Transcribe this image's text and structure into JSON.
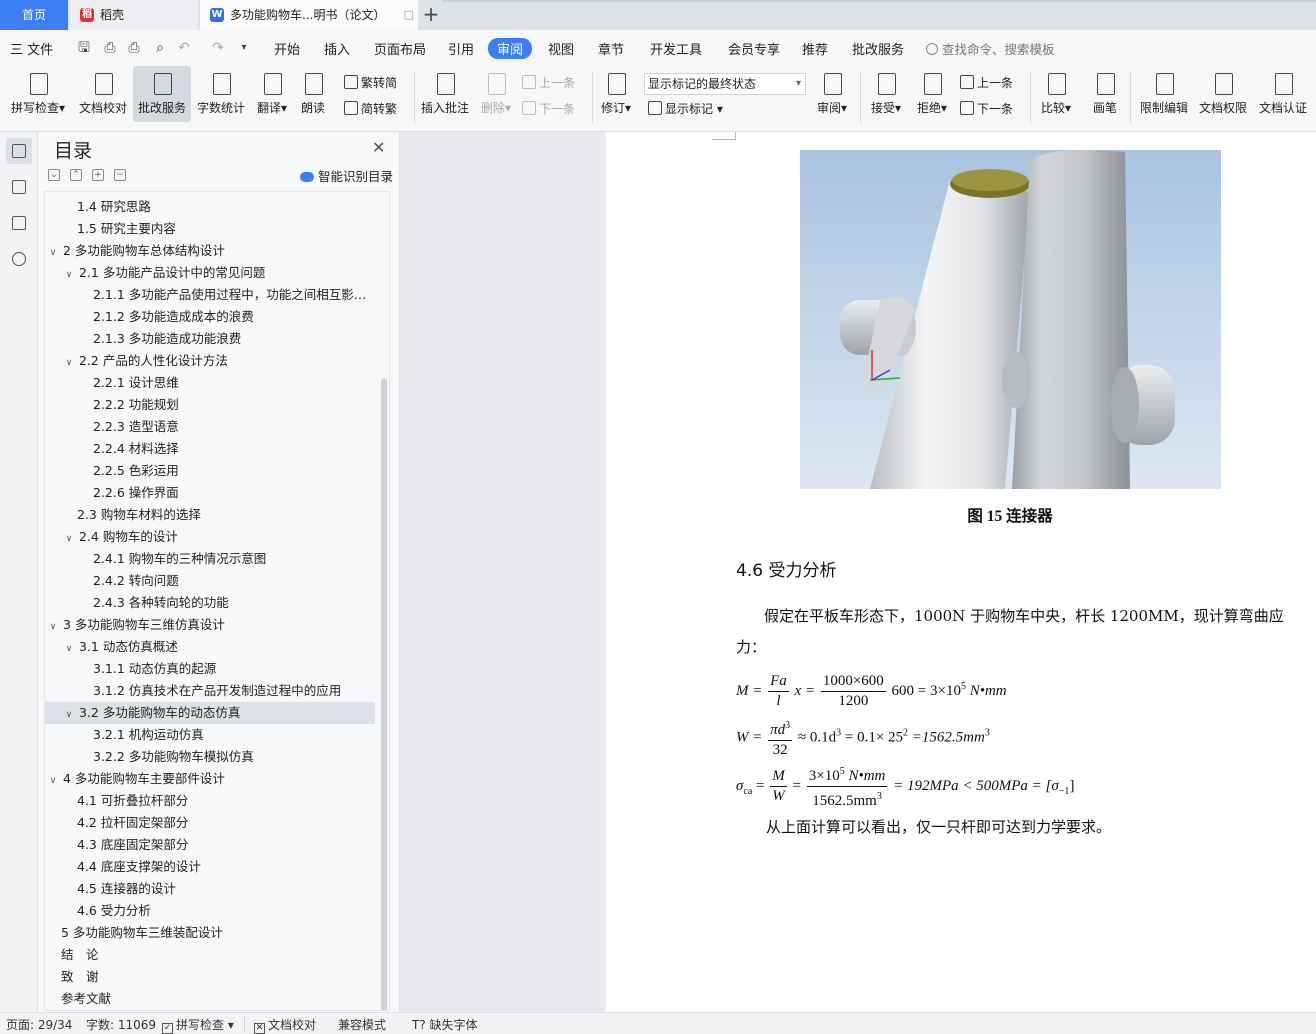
{
  "tabs": {
    "home": "首页",
    "daoke": "稻壳",
    "doc": "多功能购物车...明书（论文）"
  },
  "menubar": {
    "file": "三 文件",
    "items": [
      "开始",
      "插入",
      "页面布局",
      "引用",
      "审阅",
      "视图",
      "章节",
      "开发工具",
      "会员专享",
      "推荐",
      "批改服务"
    ],
    "active": "审阅",
    "search": "查找命令、搜索模板"
  },
  "ribbon": {
    "spell": "拼写检查",
    "proofread": "文档校对",
    "correction": "批改服务",
    "wordcount": "字数统计",
    "translate": "翻译",
    "read": "朗读",
    "trad": "繁转简",
    "simp": "简转繁",
    "insert_comment": "插入批注",
    "delete": "删除",
    "prev": "上一条",
    "next": "下一条",
    "revise": "修订",
    "markup_state": "显示标记的最终状态",
    "show_markup": "显示标记",
    "review": "审阅",
    "accept": "接受",
    "reject": "拒绝",
    "prev2": "上一条",
    "next2": "下一条",
    "compare": "比较",
    "pen": "画笔",
    "restrict": "限制编辑",
    "permission": "文档权限",
    "certify": "文档认证"
  },
  "toc": {
    "title": "目录",
    "smart": "智能识别目录",
    "items": [
      {
        "text": "1.4 研究思路",
        "level": 2,
        "arrow": ""
      },
      {
        "text": "1.5 研究主要内容",
        "level": 2,
        "arrow": ""
      },
      {
        "text": "2  多功能购物车总体结构设计",
        "level": 1,
        "arrow": "v"
      },
      {
        "text": "2.1  多功能产品设计中的常见问题",
        "level": 2,
        "arrow": "v"
      },
      {
        "text": "2.1.1  多功能产品使用过程中，功能之间相互影…",
        "level": 3,
        "arrow": ""
      },
      {
        "text": "2.1.2  多功能造成成本的浪费",
        "level": 3,
        "arrow": ""
      },
      {
        "text": "2.1.3  多功能造成功能浪费",
        "level": 3,
        "arrow": ""
      },
      {
        "text": "2.2  产品的人性化设计方法",
        "level": 2,
        "arrow": "v"
      },
      {
        "text": "2.2.1  设计思维",
        "level": 3,
        "arrow": ""
      },
      {
        "text": "2.2.2  功能规划",
        "level": 3,
        "arrow": ""
      },
      {
        "text": "2.2.3  造型语意",
        "level": 3,
        "arrow": ""
      },
      {
        "text": "2.2.4  材料选择",
        "level": 3,
        "arrow": ""
      },
      {
        "text": "2.2.5  色彩运用",
        "level": 3,
        "arrow": ""
      },
      {
        "text": "2.2.6  操作界面",
        "level": 3,
        "arrow": ""
      },
      {
        "text": "2.3  购物车材料的选择",
        "level": 2,
        "arrow": ""
      },
      {
        "text": "2.4  购物车的设计",
        "level": 2,
        "arrow": "v"
      },
      {
        "text": "2.4.1  购物车的三种情况示意图",
        "level": 3,
        "arrow": ""
      },
      {
        "text": "2.4.2  转向问题",
        "level": 3,
        "arrow": ""
      },
      {
        "text": "2.4.3 各种转向轮的功能",
        "level": 3,
        "arrow": ""
      },
      {
        "text": "3  多功能购物车三维仿真设计",
        "level": 1,
        "arrow": "v"
      },
      {
        "text": "3.1  动态仿真概述",
        "level": 2,
        "arrow": "v"
      },
      {
        "text": "3.1.1  动态仿真的起源",
        "level": 3,
        "arrow": ""
      },
      {
        "text": "3.1.2  仿真技术在产品开发制造过程中的应用",
        "level": 3,
        "arrow": ""
      },
      {
        "text": "3.2  多功能购物车的动态仿真",
        "level": 2,
        "arrow": "v",
        "selected": true
      },
      {
        "text": "3.2.1  机构运动仿真",
        "level": 3,
        "arrow": ""
      },
      {
        "text": "3.2.2  多功能购物车模拟仿真",
        "level": 3,
        "arrow": ""
      },
      {
        "text": "4  多功能购物车主要部件设计",
        "level": 1,
        "arrow": "v"
      },
      {
        "text": "4.1  可折叠拉杆部分",
        "level": 2,
        "arrow": ""
      },
      {
        "text": "4.2  拉杆固定架部分",
        "level": 2,
        "arrow": ""
      },
      {
        "text": "4.3  底座固定架部分",
        "level": 2,
        "arrow": ""
      },
      {
        "text": "4.4 底座支撑架的设计",
        "level": 2,
        "arrow": ""
      },
      {
        "text": "4.5 连接器的设计",
        "level": 2,
        "arrow": ""
      },
      {
        "text": "4.6  受力分析",
        "level": 2,
        "arrow": ""
      },
      {
        "text": "5  多功能购物车三维装配设计",
        "level": 1,
        "arrow": ""
      },
      {
        "text": "结　论",
        "level": 1,
        "arrow": ""
      },
      {
        "text": "致　谢",
        "level": 1,
        "arrow": ""
      },
      {
        "text": "参考文献",
        "level": 1,
        "arrow": ""
      }
    ]
  },
  "doc": {
    "caption": "图 15  连接器",
    "heading": "4.6  受力分析",
    "para1": "假定在平板车形态下，1000N 于购物车中央，杆长 1200MM，现计算弯曲应力：",
    "para2": "从上面计算可以看出，仅一只杆即可达到力学要求。",
    "eq1": {
      "lhs": "M =",
      "frac1_num": "Fa",
      "frac1_den": "l",
      "mid": "x =",
      "frac2_num": "1000×600",
      "frac2_den": "1200",
      "rhs": "600 = 3×10",
      "exp": "5",
      "unit": " N•mm"
    },
    "eq2": {
      "lhs": "W =",
      "frac_num": "πd",
      "frac_num_exp": "3",
      "frac_den": "32",
      "rhs1": "≈ 0.1d",
      "rhs1_exp": "3",
      "rhs2": " = 0.1× 25",
      "rhs2_exp": "2",
      "rhs3": " =1562.5mm",
      "rhs3_exp": "3"
    },
    "eq3": {
      "lhs": "σ",
      "lhs_sub": "ca",
      "eq": " =",
      "frac1_num": "M",
      "frac1_den": "W",
      "eq2": " =",
      "frac2_num": "3×10",
      "frac2_num_exp": "5",
      "frac2_num_unit": " N•mm",
      "frac2_den": "1562.5mm",
      "frac2_den_exp": "3",
      "rhs": " = 192MPa < 500MPa = [σ",
      "rhs_sub": "−1",
      "rhs_end": "]"
    }
  },
  "status": {
    "page": "页面: 29/34",
    "words": "字数: 11069",
    "spell": "拼写检查",
    "proof": "文档校对",
    "compat": "兼容模式",
    "font": "缺失字体"
  },
  "colors": {
    "accent": "#3c7ef5",
    "figure_bg_top": "#a9c3e0",
    "figure_bg_bottom": "#dde7f2"
  }
}
